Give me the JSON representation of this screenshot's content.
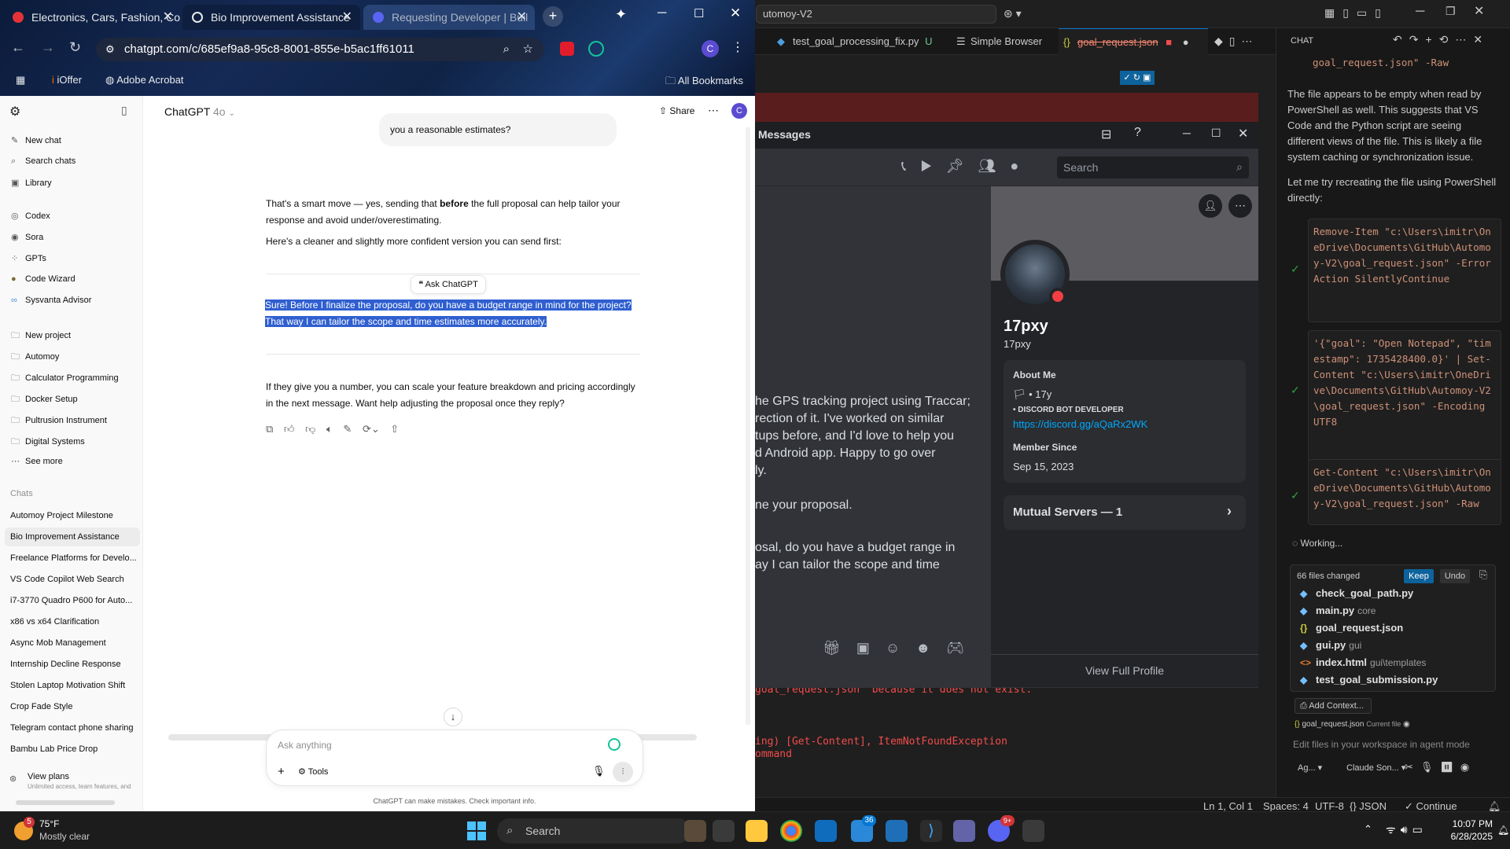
{
  "chrome": {
    "tabs": [
      {
        "label": "Electronics, Cars, Fashion, Co"
      },
      {
        "label": "Bio Improvement Assistance"
      },
      {
        "label": "Requesting Developer | Buil"
      }
    ],
    "url": "chatgpt.com/c/685ef9a8-95c8-8001-855e-b5ac1ff61011",
    "bookmarks": {
      "ioffer": "iOffer",
      "acrobat": "Adobe Acrobat",
      "all": "All Bookmarks"
    },
    "profile_initial": "C"
  },
  "chatgpt": {
    "model_title": "ChatGPT",
    "model_version": "4o",
    "share_label": "Share",
    "sidebar": {
      "new_chat": "New chat",
      "search_chats": "Search chats",
      "library": "Library",
      "codex": "Codex",
      "sora": "Sora",
      "gpts": "GPTs",
      "code_wizard": "Code Wizard",
      "sysvanta": "Sysvanta Advisor",
      "new_project": "New project",
      "projects": [
        "Automoy",
        "Calculator Programming",
        "Docker Setup",
        "Pultrusion Instrument",
        "Digital Systems"
      ],
      "see_more": "See more",
      "chats_heading": "Chats",
      "chats": [
        "Automoy Project Milestone",
        "Bio Improvement Assistance",
        "Freelance Platforms for Develo...",
        "VS Code Copilot Web Search",
        "i7-3770 Quadro P600 for Auto...",
        "x86 vs x64 Clarification",
        "Async Mob Management",
        "Internship Decline Response",
        "Stolen Laptop Motivation Shift",
        "Crop Fade Style",
        "Telegram contact phone sharing",
        "Bambu Lab Price Drop"
      ],
      "view_plans": "View plans",
      "view_plans_sub": "Unlimited access, team features, and"
    },
    "user_bubble_tail": "you a reasonable estimates?",
    "reply_p1_a": "That's a smart move — yes, sending that ",
    "reply_p1_bold": "before",
    "reply_p1_b": " the full proposal can help tailor your response and avoid under/overestimating.",
    "reply_p2": "Here's a cleaner and slightly more confident version you can send first:",
    "ask_chatgpt": "Ask ChatGPT",
    "quoted_line1": "Sure! Before I finalize the proposal, do you have a budget range in mind for the project?",
    "quoted_line2": "That way I can tailor the scope and time estimates more accurately.",
    "reply_p3": "If they give you a number, you can scale your feature breakdown and pricing accordingly in the next message. Want help adjusting the proposal once they reply?",
    "composer_placeholder": "Ask anything",
    "tools_label": "Tools",
    "disclaimer": "ChatGPT can make mistakes. Check important info."
  },
  "vscode": {
    "command_center": "utomoy-V2",
    "tabs": [
      {
        "label": "test_goal_processing_fix.py",
        "suffix": "U"
      },
      {
        "label": "Simple Browser"
      },
      {
        "label": "goal_request.json"
      }
    ],
    "terminal_lines": [
      "goal_request.json' because it does not exist.",
      "ing) [Get-Content], ItemNotFoundException",
      "ommand"
    ],
    "status": {
      "position": "Ln 1, Col 1",
      "spaces": "Spaces: 4",
      "encoding": "UTF-8",
      "language": "{} JSON",
      "continue": "Continue"
    }
  },
  "copilot_chat": {
    "header": "CHAT",
    "top_code_tail": "goal_request.json\" -Raw",
    "para1": "The file appears to be empty when read by PowerShell as well. This suggests that VS Code and the Python script are seeing different views of the file. This is likely a file system caching or synchronization issue.",
    "para2": "Let me try recreating the file using PowerShell directly:",
    "code1": "Remove-Item \"c:\\Users\\imitr\\OneDrive\\Documents\\GitHub\\Automoy-V2\\goal_request.json\" -ErrorAction SilentlyContinue",
    "code2": "'{\"goal\": \"Open Notepad\", \"timestamp\": 1735428400.0}' | Set-Content \"c:\\Users\\imitr\\OneDrive\\Documents\\GitHub\\Automoy-V2\\goal_request.json\" -Encoding UTF8",
    "code3": "Get-Content \"c:\\Users\\imitr\\OneDrive\\Documents\\GitHub\\Automoy-V2\\goal_request.json\" -Raw",
    "working": "Working...",
    "files_changed": "66 files changed",
    "keep": "Keep",
    "undo": "Undo",
    "files": [
      {
        "name": "check_goal_path.py",
        "sub": ""
      },
      {
        "name": "main.py",
        "sub": "core"
      },
      {
        "name": "goal_request.json",
        "sub": ""
      },
      {
        "name": "gui.py",
        "sub": "gui"
      },
      {
        "name": "index.html",
        "sub": "gui\\templates"
      },
      {
        "name": "test_goal_submission.py",
        "sub": ""
      }
    ],
    "add_context": "Add Context...",
    "current_file": "goal_request.json",
    "current_file_tag": "Current file",
    "input_placeholder": "Edit files in your workspace in agent mode",
    "agent_label": "Ag...",
    "model_label": "Claude Son..."
  },
  "discord": {
    "title": "Messages",
    "search_placeholder": "Search",
    "chat_lines": [
      "he GPS tracking project using Traccar;",
      "rection of it. I've worked on similar",
      "tups before, and I'd love to help you",
      "d Android app. Happy to go over",
      "ly.",
      "",
      "ne your proposal.",
      "",
      "osal, do you have a budget range in",
      "ay I can tailor the scope and time"
    ],
    "profile": {
      "display_name": "17pxy",
      "username": "17pxy",
      "about_heading": "About Me",
      "about_line": "• 17y",
      "about_role": "• DISCORD BOT DEVELOPER",
      "about_link": "https://discord.gg/aQaRx2WK",
      "member_since_heading": "Member Since",
      "member_since": "Sep 15, 2023",
      "mutual_servers": "Mutual Servers — 1",
      "view_full_profile": "View Full Profile"
    }
  },
  "taskbar": {
    "weather_temp": "75°F",
    "weather_desc": "Mostly clear",
    "weather_badge": "5",
    "search_label": "Search",
    "time": "10:07 PM",
    "date": "6/28/2025",
    "badge_mail": "36",
    "badge_discord": "9+"
  }
}
